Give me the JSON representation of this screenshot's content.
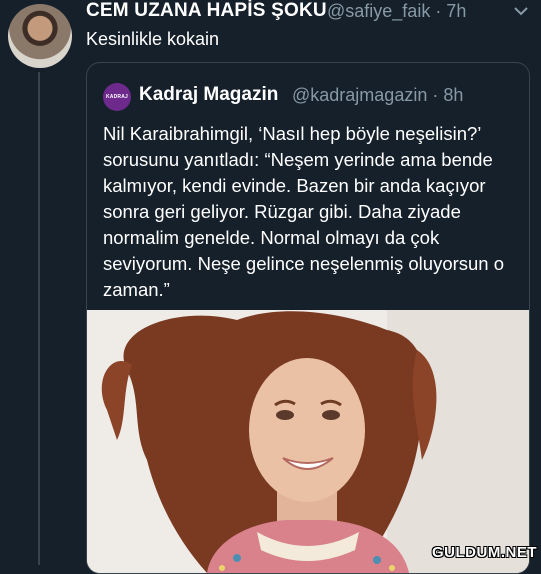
{
  "tweet": {
    "author_name": "CEM UZANA HAPİS ŞOKU",
    "author_handle": "@safiye_faik · 7h",
    "text": "Kesinlikle kokain",
    "avatar": "avatar-photo",
    "menu_icon": "chevron-down-icon"
  },
  "quoted": {
    "logo_text": "KADRAJ",
    "author_name": "Kadraj Magazin",
    "author_handle": "@kadrajmagazin · 8h",
    "text": "Nil Karaibrahimgil, ‘Nasıl hep böyle neşelisin?’ sorusunu yanıtladı: “Neşem yerinde ama bende kalmıyor, kendi evinde. Bazen bir anda kaçıyor sonra geri geliyor. Rüzgar gibi. Daha ziyade normalim genelde. Normal olmayı da çok seviyorum. Neşe gelince neşelenmiş oluyorsun o zaman.”",
    "logo_color": "#6d2a8c"
  },
  "watermark": "GULDUM.NET",
  "colors": {
    "background": "#15202b",
    "secondary_text": "#8899a6",
    "border": "#38444d"
  }
}
